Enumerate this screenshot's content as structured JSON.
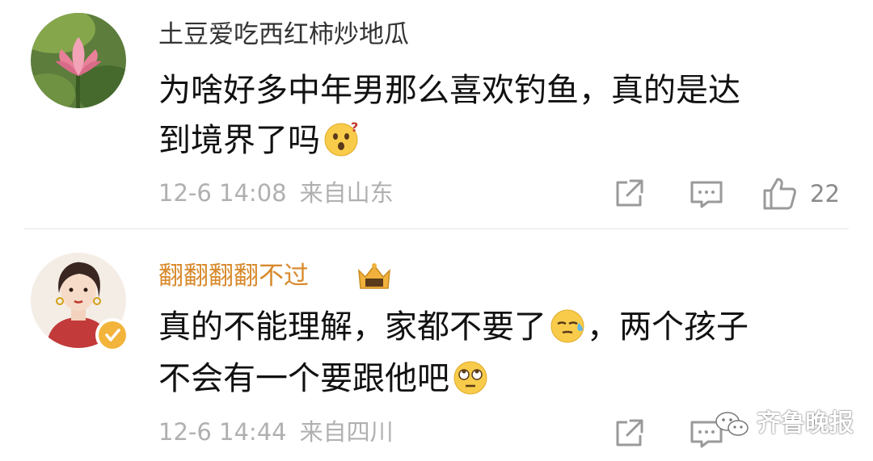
{
  "colors": {
    "username_default": "#333333",
    "username_vip": "#d88a2d",
    "meta": "#b0b0b0",
    "verify_badge": "#f2b43b"
  },
  "comments": [
    {
      "username": "土豆爱吃西红柿炒地瓜",
      "avatar": "lotus-flower-avatar",
      "text_line1": "为啥好多中年男那么喜欢钓鱼，真的是达",
      "text_line2": "到境界了吗",
      "emoji": "surprised-face-icon",
      "date": "12-6 14:08",
      "location": "来自山东",
      "likes": "22"
    },
    {
      "username": "翻翻翻翻不过",
      "avatar": "illustrated-woman-avatar",
      "badge": "crown-icon",
      "verified": "verified-badge-icon",
      "text_line1a": "真的不能理解，家都不要了",
      "emoji1": "sweat-face-icon",
      "text_line1b": "，两个孩子",
      "text_line2": "不会有一个要跟他吧",
      "emoji2": "eye-roll-face-icon",
      "date": "12-6 14:44",
      "location": "来自四川"
    }
  ],
  "actions": {
    "share_icon": "share-icon",
    "reply_icon": "reply-icon",
    "like_icon": "thumbs-up-icon"
  },
  "watermark": {
    "text": "齐鲁晚报",
    "icon": "wechat-icon"
  }
}
